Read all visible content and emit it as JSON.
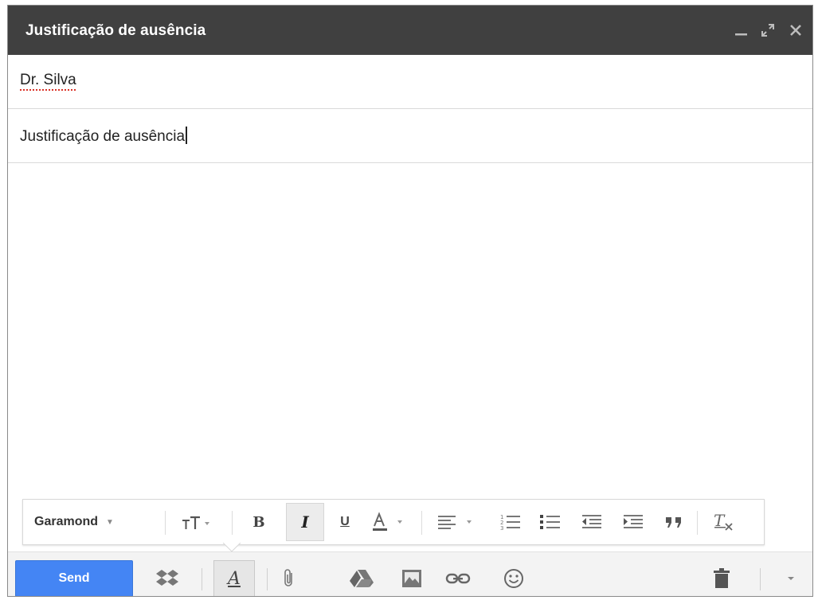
{
  "window": {
    "title": "Justificação de ausência",
    "minimize_icon": "minimize-icon",
    "expand_icon": "expand-icon",
    "close_icon": "close-icon"
  },
  "compose": {
    "to": "Dr. Silva",
    "subject": "Justificação de ausência",
    "body": ""
  },
  "formatting": {
    "font_family": "Garamond",
    "tools": [
      "font-size-icon",
      "bold-icon",
      "italic-icon",
      "underline-icon",
      "text-color-icon",
      "align-icon",
      "numbered-list-icon",
      "bulleted-list-icon",
      "indent-less-icon",
      "indent-more-icon",
      "quote-icon",
      "remove-formatting-icon"
    ],
    "active_tool": "italic"
  },
  "actions": {
    "send_label": "Send",
    "icons": [
      "dropbox-icon",
      "formatting-toggle-icon",
      "attach-icon",
      "drive-icon",
      "photo-icon",
      "link-icon",
      "emoji-icon",
      "trash-icon",
      "more-options-icon"
    ]
  },
  "colors": {
    "titlebar": "#404040",
    "send_button": "#4485f4",
    "spellcheck": "#d93025"
  }
}
